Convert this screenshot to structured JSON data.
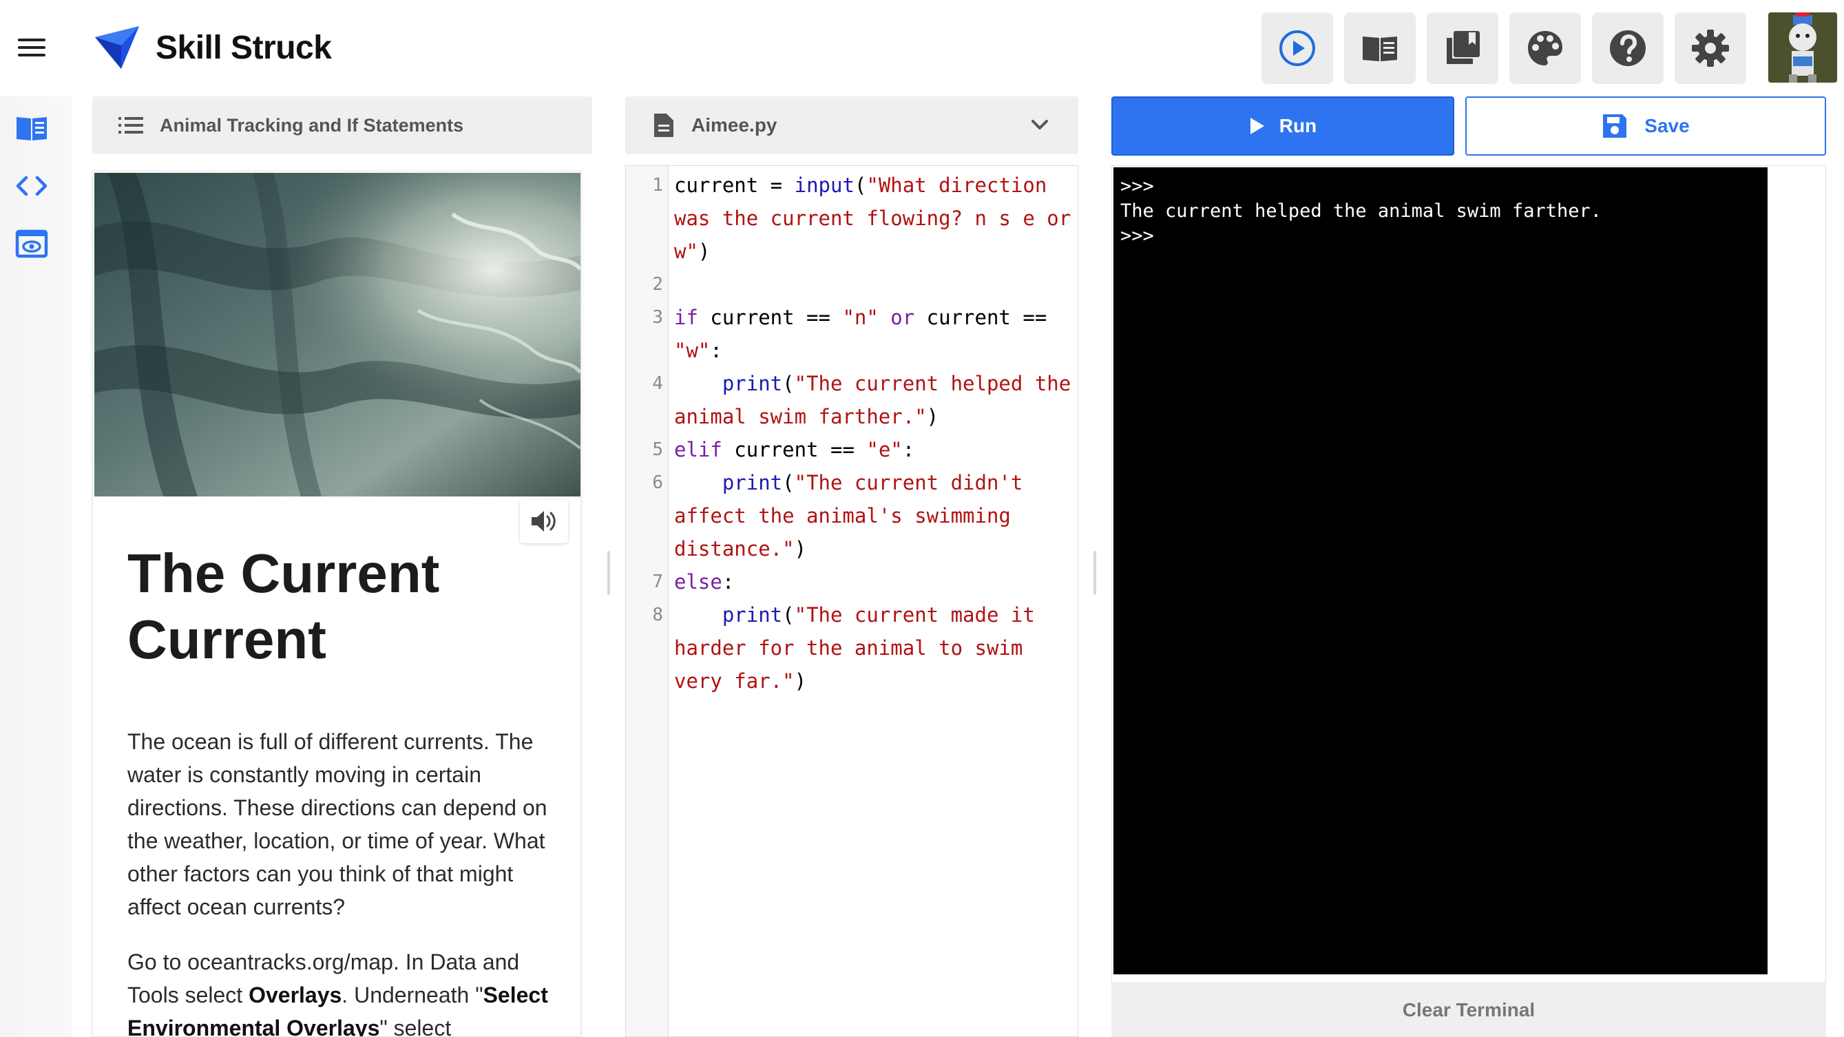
{
  "header": {
    "brand": "Skill Struck",
    "tools": [
      {
        "name": "play-icon"
      },
      {
        "name": "book-icon"
      },
      {
        "name": "library-icon"
      },
      {
        "name": "palette-icon"
      },
      {
        "name": "help-icon"
      },
      {
        "name": "gear-icon"
      }
    ]
  },
  "rail": {
    "items": [
      {
        "name": "book-icon"
      },
      {
        "name": "code-icon"
      },
      {
        "name": "preview-icon"
      }
    ]
  },
  "lesson": {
    "bar_title": "Animal Tracking and If Statements",
    "heading": "The Current Current",
    "paragraph1": "The ocean is full of different currents. The water is constantly moving in certain directions. These directions can depend on the weather, location, or time of year. What other factors can you think of that might affect ocean currents?",
    "p2_a": "Go to oceantracks.org/map. In Data and Tools select ",
    "p2_b": "Overlays",
    "p2_c": ". Underneath \"",
    "p2_d": "Select Environmental Overlays",
    "p2_e": "\" select"
  },
  "editor": {
    "filename": "Aimee.py",
    "lines": [
      {
        "n": "1",
        "tokens": [
          [
            "current = ",
            ""
          ],
          [
            "input",
            "fn"
          ],
          [
            "(",
            ""
          ],
          [
            "\"What direction was the current flowing? n s e or w\"",
            "str"
          ],
          [
            ")",
            ""
          ]
        ]
      },
      {
        "n": "2",
        "tokens": []
      },
      {
        "n": "3",
        "tokens": [
          [
            "if",
            "kw"
          ],
          [
            " current == ",
            ""
          ],
          [
            "\"n\"",
            "str"
          ],
          [
            " ",
            ""
          ],
          [
            "or",
            "kw"
          ],
          [
            " current == ",
            ""
          ],
          [
            "\"w\"",
            "str"
          ],
          [
            ":",
            ""
          ]
        ]
      },
      {
        "n": "4",
        "tokens": [
          [
            "    ",
            ""
          ],
          [
            "print",
            "fn"
          ],
          [
            "(",
            ""
          ],
          [
            "\"The current helped the animal swim farther.\"",
            "str"
          ],
          [
            ")",
            ""
          ]
        ]
      },
      {
        "n": "5",
        "tokens": [
          [
            "elif",
            "kw"
          ],
          [
            " current == ",
            ""
          ],
          [
            "\"e\"",
            "str"
          ],
          [
            ":",
            ""
          ]
        ]
      },
      {
        "n": "6",
        "tokens": [
          [
            "    ",
            ""
          ],
          [
            "print",
            "fn"
          ],
          [
            "(",
            ""
          ],
          [
            "\"The current didn't affect the animal's swimming distance.\"",
            "str"
          ],
          [
            ")",
            ""
          ]
        ]
      },
      {
        "n": "7",
        "tokens": [
          [
            "else",
            "kw"
          ],
          [
            ":",
            ""
          ]
        ]
      },
      {
        "n": "8",
        "tokens": [
          [
            "    ",
            ""
          ],
          [
            "print",
            "fn"
          ],
          [
            "(",
            ""
          ],
          [
            "\"The current made it harder for the animal to swim very far.\"",
            "str"
          ],
          [
            ")",
            ""
          ]
        ]
      }
    ]
  },
  "actions": {
    "run_label": "Run",
    "save_label": "Save",
    "clear_label": "Clear Terminal"
  },
  "terminal": {
    "lines": [
      ">>>",
      "The current helped the animal swim farther.",
      ">>>"
    ]
  },
  "colors": {
    "accent": "#2e74f0",
    "keyword": "#7a1fa2",
    "builtin": "#1b1bb3",
    "string": "#b11212"
  }
}
